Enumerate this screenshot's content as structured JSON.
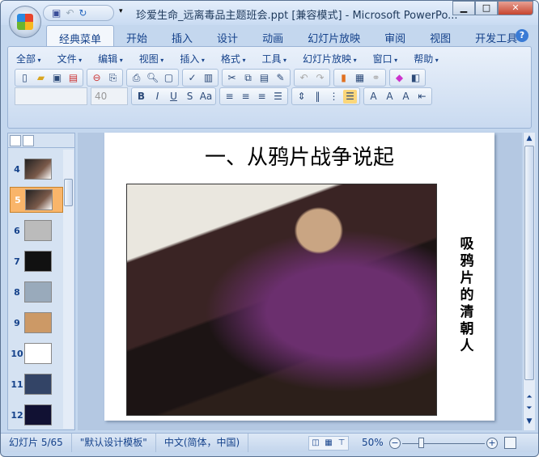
{
  "window": {
    "title": "珍爱生命_远离毒品主题班会.ppt [兼容模式] - Microsoft PowerPo..."
  },
  "ribbon_tabs": [
    "经典菜单",
    "开始",
    "插入",
    "设计",
    "动画",
    "幻灯片放映",
    "审阅",
    "视图",
    "开发工具"
  ],
  "classic_menu": [
    "全部",
    "文件",
    "编辑",
    "视图",
    "插入",
    "格式",
    "工具",
    "幻灯片放映",
    "窗口",
    "帮助"
  ],
  "toolbar": {
    "font_name": "",
    "font_size": "40"
  },
  "thumbnails": [
    {
      "n": "4"
    },
    {
      "n": "5",
      "selected": true
    },
    {
      "n": "6"
    },
    {
      "n": "7"
    },
    {
      "n": "8"
    },
    {
      "n": "9"
    },
    {
      "n": "10"
    },
    {
      "n": "11"
    },
    {
      "n": "12"
    }
  ],
  "slide": {
    "title": "一、从鸦片战争说起",
    "caption": "吸鸦片的清朝人"
  },
  "status": {
    "slide": "幻灯片 5/65",
    "theme": "\"默认设计模板\"",
    "language": "中文(简体，中国)",
    "zoom": "50%"
  }
}
